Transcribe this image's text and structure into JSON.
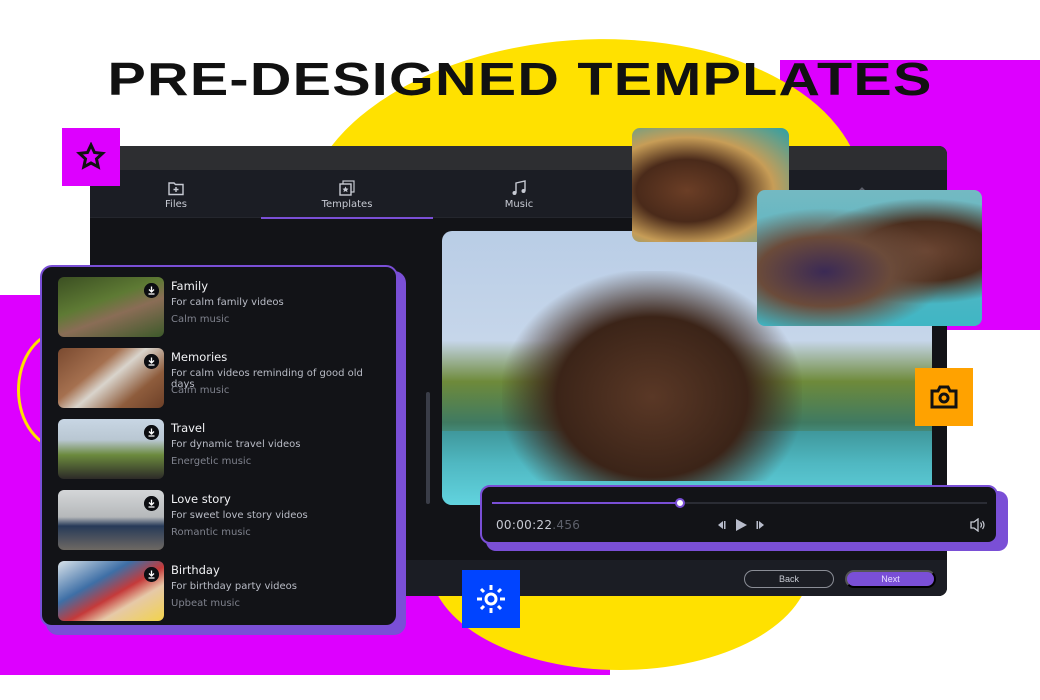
{
  "headline": "PRE-DESIGNED TEMPLATES",
  "colors": {
    "accent": "#7a4fd6",
    "magenta": "#dd00ff",
    "yellow": "#ffe100",
    "orange": "#ffa200",
    "blue": "#0044ff",
    "window_bg": "#121317"
  },
  "tabs": [
    {
      "label": "Files",
      "icon": "folder-plus-icon"
    },
    {
      "label": "Templates",
      "icon": "templates-star-icon",
      "active": true
    },
    {
      "label": "Music",
      "icon": "music-note-icon"
    },
    {
      "label": "",
      "icon": "upload-arrow-icon"
    }
  ],
  "templates": [
    {
      "name": "Family",
      "description": "For calm family videos",
      "music": "Calm music"
    },
    {
      "name": "Memories",
      "description": "For calm videos reminding of good old days",
      "music": "Calm music"
    },
    {
      "name": "Travel",
      "description": "For dynamic travel videos",
      "music": "Energetic music"
    },
    {
      "name": "Love story",
      "description": "For sweet love story videos",
      "music": "Romantic music"
    },
    {
      "name": "Birthday",
      "description": "For birthday party videos",
      "music": "Upbeat music"
    }
  ],
  "player": {
    "time_main": "00:00:22",
    "time_ms": ".456",
    "progress_fraction": 0.38
  },
  "footer": {
    "back_label": "Back",
    "next_label": "Next"
  },
  "badges": [
    "star-icon",
    "camera-icon",
    "sun-icon"
  ]
}
